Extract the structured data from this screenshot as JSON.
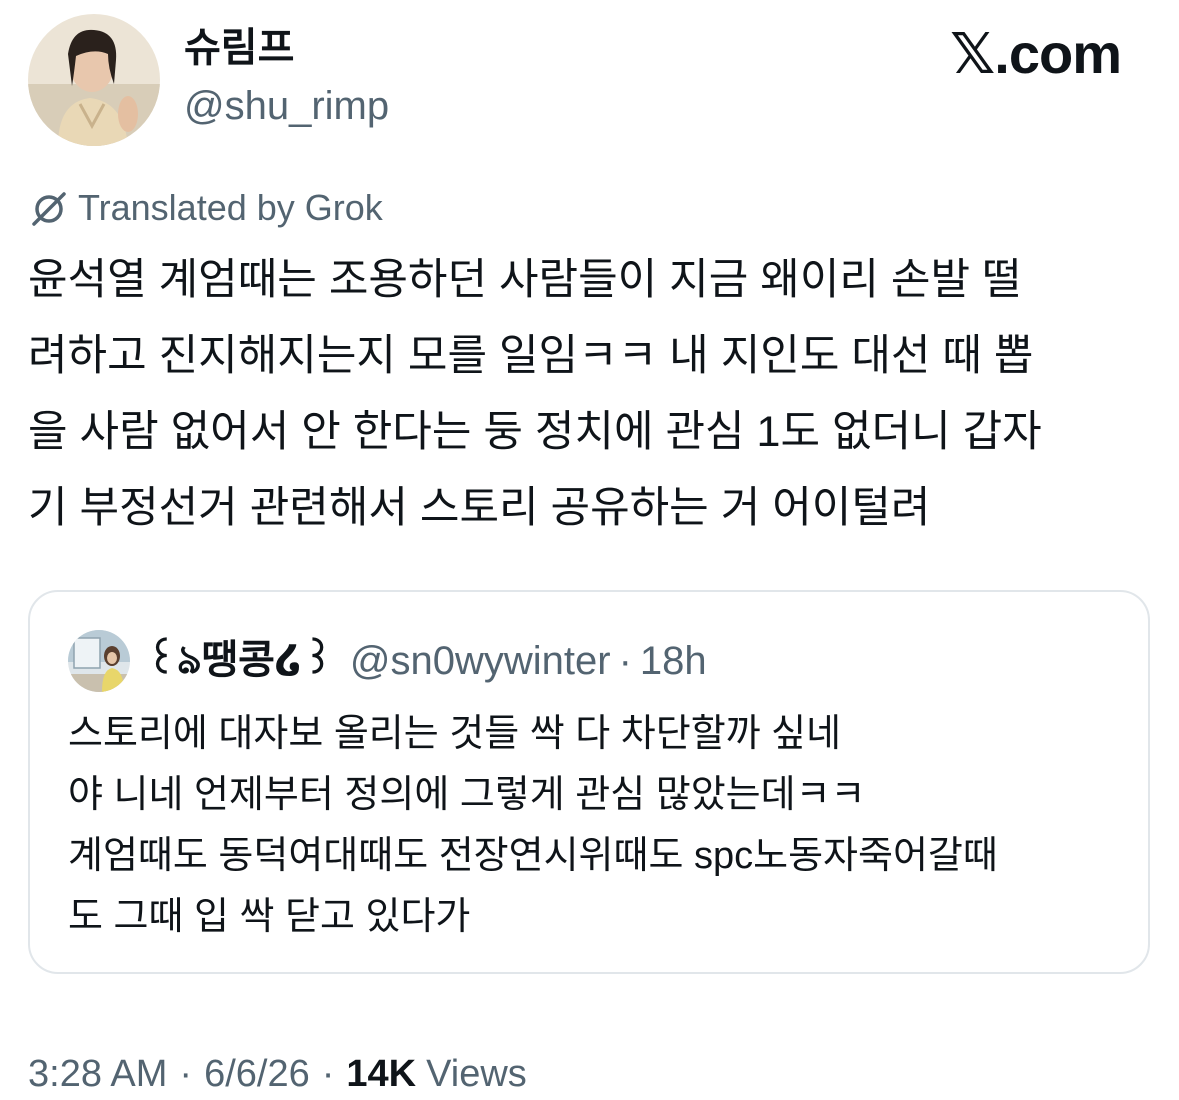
{
  "author": {
    "display_name": "슈림프",
    "handle": "@shu_rimp",
    "avatar_icon": "profile-photo"
  },
  "site_badge": {
    "glyph": "𝕏",
    "text": ".com"
  },
  "translation": {
    "icon": "grok-icon",
    "label": "Translated by Grok"
  },
  "tweet": {
    "lines": [
      "윤석열 계엄때는 조용하던 사람들이 지금 왜이리 손발 떨",
      "려하고 진지해지는지 모를 일임ㅋㅋ 내 지인도 대선 때 뽑",
      "을 사람 없어서 안 한다는 둥 정치에 관심 1도 없더니 갑자",
      "기 부정선거 관련해서 스토리 공유하는 거 어이털려"
    ]
  },
  "quote": {
    "display_name": "꒰ঌ땡콩໒꒱",
    "handle": "@sn0wywinter",
    "separator": "·",
    "time": "18h",
    "lines": [
      "스토리에 대자보 올리는 것들 싹 다 차단할까 싶네",
      "야 니네 언제부터 정의에 그렇게 관심 많았는데ㅋㅋ",
      "계엄때도 동덕여대때도 전장연시위때도 spc노동자죽어갈때",
      "도 그때 입 싹 닫고 있다가"
    ]
  },
  "meta": {
    "time": "3:28 AM",
    "separator": "·",
    "date": "6/6/26",
    "views_count": "14K",
    "views_label": "Views"
  },
  "colors": {
    "text_primary": "#0f1419",
    "text_secondary": "#536471",
    "border": "#e1e6ea",
    "background": "#ffffff"
  }
}
